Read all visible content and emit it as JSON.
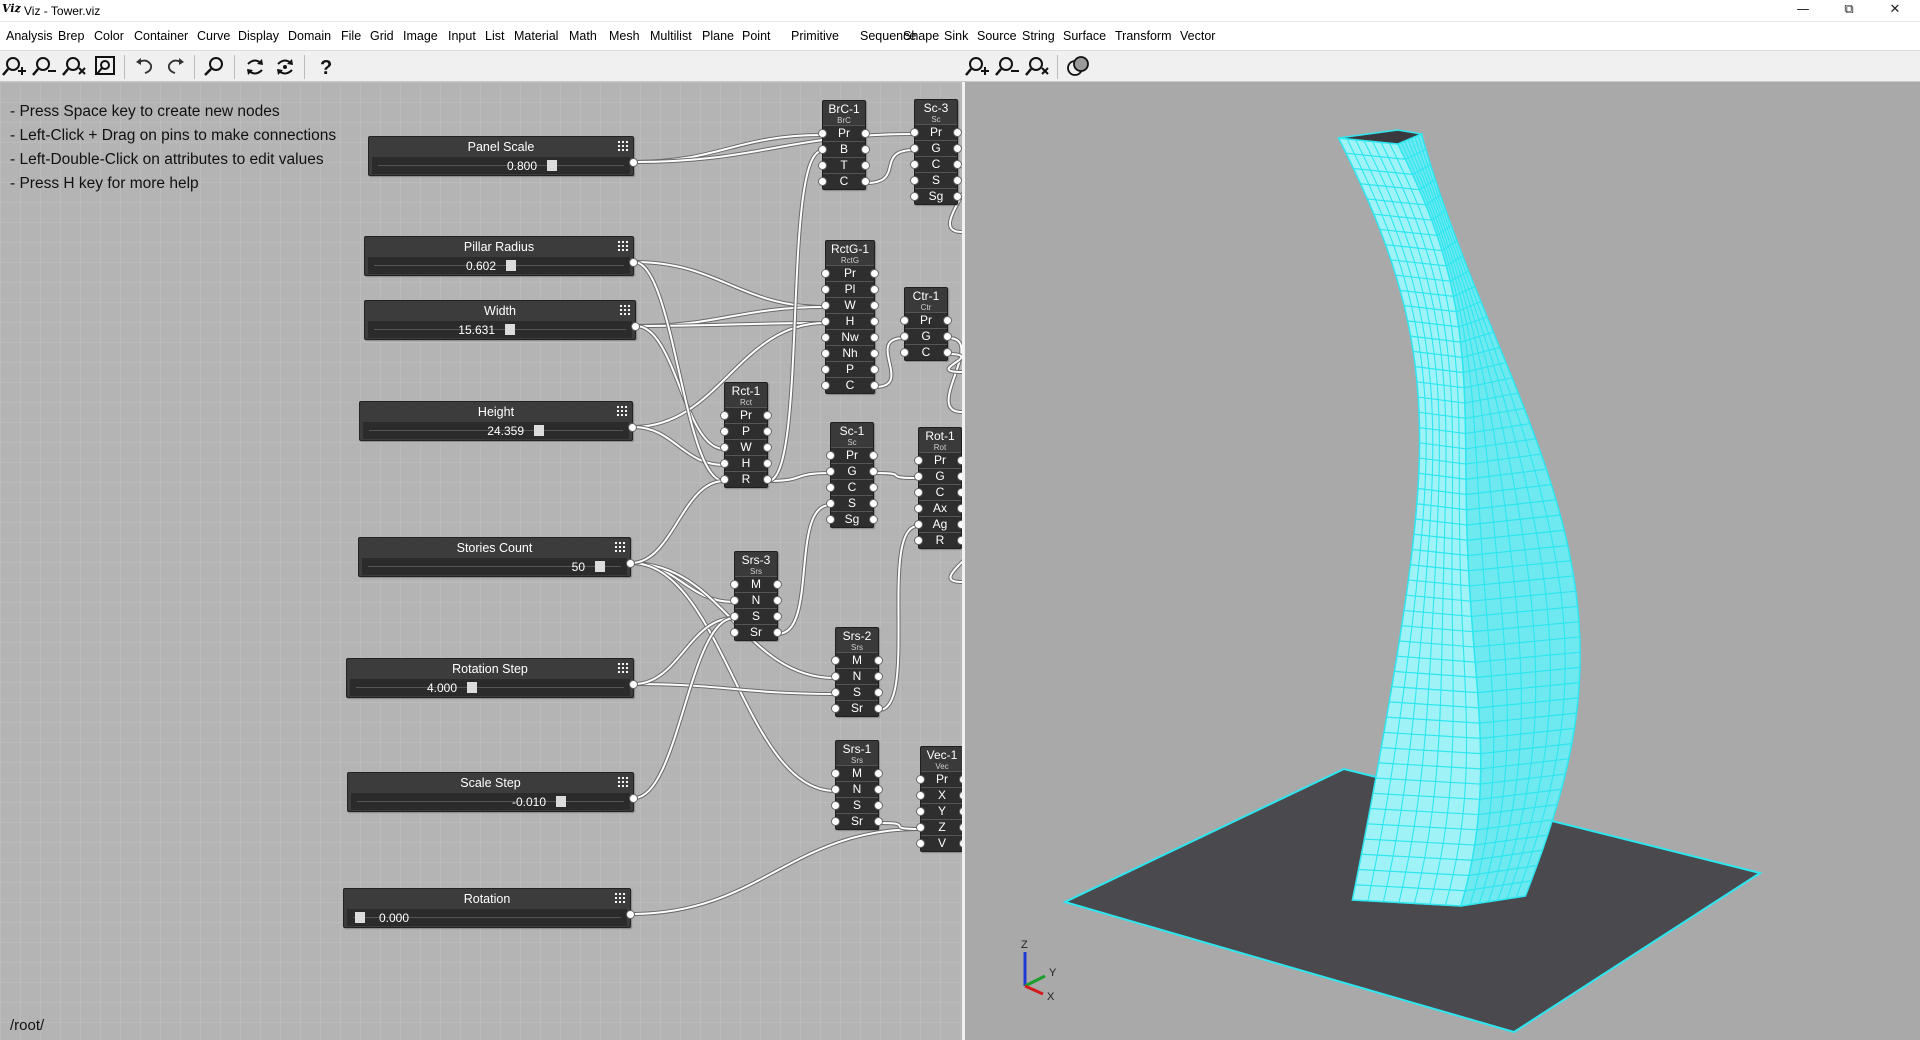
{
  "window": {
    "logo": "Viz",
    "title": "Viz - Tower.viz"
  },
  "menu": [
    "Analysis",
    "Brep",
    "Color",
    "Container",
    "Curve",
    "Display",
    "Domain",
    "File",
    "Grid",
    "Image",
    "Input",
    "List",
    "Material",
    "Math",
    "Mesh",
    "Multilist",
    "Plane",
    "Point",
    "Primitive",
    "Sequence",
    "Shape",
    "Sink",
    "Source",
    "String",
    "Surface",
    "Transform",
    "Vector"
  ],
  "toolbar": {
    "left": [
      "zoom-in-icon",
      "zoom-out-icon",
      "zoom-reset-icon",
      "zoom-fit-icon",
      "undo-icon",
      "redo-icon",
      "search-icon",
      "refresh-icon",
      "refresh-all-icon",
      "help-icon"
    ],
    "right": [
      "zoom-in-icon",
      "zoom-out-icon",
      "zoom-reset-icon",
      "shading-icon"
    ]
  },
  "help": [
    "- Press Space key to create new nodes",
    "- Left-Click + Drag on pins to make connections",
    "- Left-Double-Click on attributes to edit values",
    "- Press H key for more help"
  ],
  "path": "/root/",
  "sliders": [
    {
      "id": "panel-scale",
      "title": "Panel Scale",
      "value": "0.800",
      "fraction": 0.72
    },
    {
      "id": "pillar-radius",
      "title": "Pillar Radius",
      "value": "0.602",
      "fraction": 0.55
    },
    {
      "id": "width",
      "title": "Width",
      "value": "15.631",
      "fraction": 0.54
    },
    {
      "id": "height",
      "title": "Height",
      "value": "24.359",
      "fraction": 0.68
    },
    {
      "id": "stories-count",
      "title": "Stories Count",
      "value": "50",
      "fraction": 0.94
    },
    {
      "id": "rotation-step",
      "title": "Rotation Step",
      "value": "4.000",
      "fraction": 0.43
    },
    {
      "id": "scale-step",
      "title": "Scale Step",
      "value": "-0.010",
      "fraction": 0.78
    },
    {
      "id": "rotation",
      "title": "Rotation",
      "value": "0.000",
      "fraction": 0.0
    }
  ],
  "nodes": [
    {
      "id": "BrC-1",
      "title": "BrC-1",
      "sub": "BrC",
      "ports": [
        "Pr",
        "B",
        "T",
        "C"
      ]
    },
    {
      "id": "Sc-3",
      "title": "Sc-3",
      "sub": "Sc",
      "ports": [
        "Pr",
        "G",
        "C",
        "S",
        "Sg"
      ]
    },
    {
      "id": "RctG-1",
      "title": "RctG-1",
      "sub": "RctG",
      "ports": [
        "Pr",
        "Pl",
        "W",
        "H",
        "Nw",
        "Nh",
        "P",
        "C"
      ]
    },
    {
      "id": "Ctr-1",
      "title": "Ctr-1",
      "sub": "Ctr",
      "ports": [
        "Pr",
        "G",
        "C"
      ]
    },
    {
      "id": "Rct-1",
      "title": "Rct-1",
      "sub": "Rct",
      "ports": [
        "Pr",
        "P",
        "W",
        "H",
        "R"
      ]
    },
    {
      "id": "Sc-1",
      "title": "Sc-1",
      "sub": "Sc",
      "ports": [
        "Pr",
        "G",
        "C",
        "S",
        "Sg"
      ]
    },
    {
      "id": "Rot-1",
      "title": "Rot-1",
      "sub": "Rot",
      "ports": [
        "Pr",
        "G",
        "C",
        "Ax",
        "Ag",
        "R"
      ]
    },
    {
      "id": "Srs-3",
      "title": "Srs-3",
      "sub": "Srs",
      "ports": [
        "M",
        "N",
        "S",
        "Sr"
      ]
    },
    {
      "id": "Srs-2",
      "title": "Srs-2",
      "sub": "Srs",
      "ports": [
        "M",
        "N",
        "S",
        "Sr"
      ]
    },
    {
      "id": "Srs-1",
      "title": "Srs-1",
      "sub": "Srs",
      "ports": [
        "M",
        "N",
        "S",
        "Sr"
      ]
    },
    {
      "id": "Vec-1",
      "title": "Vec-1",
      "sub": "Vec",
      "ports": [
        "Pr",
        "X",
        "Y",
        "Z",
        "V"
      ]
    }
  ],
  "axes": {
    "z": "Z",
    "y": "Y",
    "x": "X"
  },
  "colors": {
    "canvas": "#b4b4b4",
    "viewport": "#a9a9a9",
    "node": "#3a3a3a",
    "mesh": "#2ee6f0",
    "ground": "#4a4a4e"
  }
}
